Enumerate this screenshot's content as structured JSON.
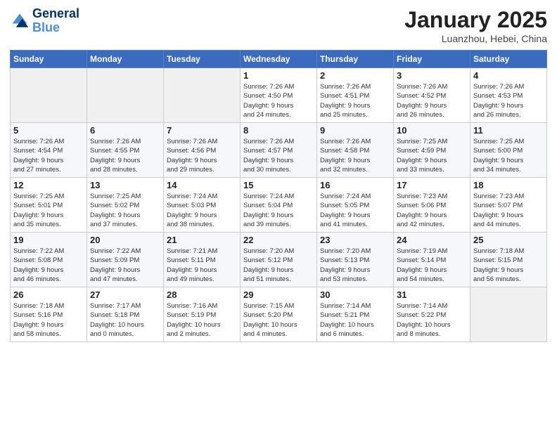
{
  "logo": {
    "line1": "General",
    "line2": "Blue"
  },
  "title": "January 2025",
  "location": "Luanzhou, Hebei, China",
  "days_of_week": [
    "Sunday",
    "Monday",
    "Tuesday",
    "Wednesday",
    "Thursday",
    "Friday",
    "Saturday"
  ],
  "weeks": [
    [
      {
        "day": "",
        "info": ""
      },
      {
        "day": "",
        "info": ""
      },
      {
        "day": "",
        "info": ""
      },
      {
        "day": "1",
        "info": "Sunrise: 7:26 AM\nSunset: 4:50 PM\nDaylight: 9 hours\nand 24 minutes."
      },
      {
        "day": "2",
        "info": "Sunrise: 7:26 AM\nSunset: 4:51 PM\nDaylight: 9 hours\nand 25 minutes."
      },
      {
        "day": "3",
        "info": "Sunrise: 7:26 AM\nSunset: 4:52 PM\nDaylight: 9 hours\nand 26 minutes."
      },
      {
        "day": "4",
        "info": "Sunrise: 7:26 AM\nSunset: 4:53 PM\nDaylight: 9 hours\nand 26 minutes."
      }
    ],
    [
      {
        "day": "5",
        "info": "Sunrise: 7:26 AM\nSunset: 4:54 PM\nDaylight: 9 hours\nand 27 minutes."
      },
      {
        "day": "6",
        "info": "Sunrise: 7:26 AM\nSunset: 4:55 PM\nDaylight: 9 hours\nand 28 minutes."
      },
      {
        "day": "7",
        "info": "Sunrise: 7:26 AM\nSunset: 4:56 PM\nDaylight: 9 hours\nand 29 minutes."
      },
      {
        "day": "8",
        "info": "Sunrise: 7:26 AM\nSunset: 4:57 PM\nDaylight: 9 hours\nand 30 minutes."
      },
      {
        "day": "9",
        "info": "Sunrise: 7:26 AM\nSunset: 4:58 PM\nDaylight: 9 hours\nand 32 minutes."
      },
      {
        "day": "10",
        "info": "Sunrise: 7:25 AM\nSunset: 4:59 PM\nDaylight: 9 hours\nand 33 minutes."
      },
      {
        "day": "11",
        "info": "Sunrise: 7:25 AM\nSunset: 5:00 PM\nDaylight: 9 hours\nand 34 minutes."
      }
    ],
    [
      {
        "day": "12",
        "info": "Sunrise: 7:25 AM\nSunset: 5:01 PM\nDaylight: 9 hours\nand 35 minutes."
      },
      {
        "day": "13",
        "info": "Sunrise: 7:25 AM\nSunset: 5:02 PM\nDaylight: 9 hours\nand 37 minutes."
      },
      {
        "day": "14",
        "info": "Sunrise: 7:24 AM\nSunset: 5:03 PM\nDaylight: 9 hours\nand 38 minutes."
      },
      {
        "day": "15",
        "info": "Sunrise: 7:24 AM\nSunset: 5:04 PM\nDaylight: 9 hours\nand 39 minutes."
      },
      {
        "day": "16",
        "info": "Sunrise: 7:24 AM\nSunset: 5:05 PM\nDaylight: 9 hours\nand 41 minutes."
      },
      {
        "day": "17",
        "info": "Sunrise: 7:23 AM\nSunset: 5:06 PM\nDaylight: 9 hours\nand 42 minutes."
      },
      {
        "day": "18",
        "info": "Sunrise: 7:23 AM\nSunset: 5:07 PM\nDaylight: 9 hours\nand 44 minutes."
      }
    ],
    [
      {
        "day": "19",
        "info": "Sunrise: 7:22 AM\nSunset: 5:08 PM\nDaylight: 9 hours\nand 46 minutes."
      },
      {
        "day": "20",
        "info": "Sunrise: 7:22 AM\nSunset: 5:09 PM\nDaylight: 9 hours\nand 47 minutes."
      },
      {
        "day": "21",
        "info": "Sunrise: 7:21 AM\nSunset: 5:11 PM\nDaylight: 9 hours\nand 49 minutes."
      },
      {
        "day": "22",
        "info": "Sunrise: 7:20 AM\nSunset: 5:12 PM\nDaylight: 9 hours\nand 51 minutes."
      },
      {
        "day": "23",
        "info": "Sunrise: 7:20 AM\nSunset: 5:13 PM\nDaylight: 9 hours\nand 53 minutes."
      },
      {
        "day": "24",
        "info": "Sunrise: 7:19 AM\nSunset: 5:14 PM\nDaylight: 9 hours\nand 54 minutes."
      },
      {
        "day": "25",
        "info": "Sunrise: 7:18 AM\nSunset: 5:15 PM\nDaylight: 9 hours\nand 56 minutes."
      }
    ],
    [
      {
        "day": "26",
        "info": "Sunrise: 7:18 AM\nSunset: 5:16 PM\nDaylight: 9 hours\nand 58 minutes."
      },
      {
        "day": "27",
        "info": "Sunrise: 7:17 AM\nSunset: 5:18 PM\nDaylight: 10 hours\nand 0 minutes."
      },
      {
        "day": "28",
        "info": "Sunrise: 7:16 AM\nSunset: 5:19 PM\nDaylight: 10 hours\nand 2 minutes."
      },
      {
        "day": "29",
        "info": "Sunrise: 7:15 AM\nSunset: 5:20 PM\nDaylight: 10 hours\nand 4 minutes."
      },
      {
        "day": "30",
        "info": "Sunrise: 7:14 AM\nSunset: 5:21 PM\nDaylight: 10 hours\nand 6 minutes."
      },
      {
        "day": "31",
        "info": "Sunrise: 7:14 AM\nSunset: 5:22 PM\nDaylight: 10 hours\nand 8 minutes."
      },
      {
        "day": "",
        "info": ""
      }
    ]
  ]
}
